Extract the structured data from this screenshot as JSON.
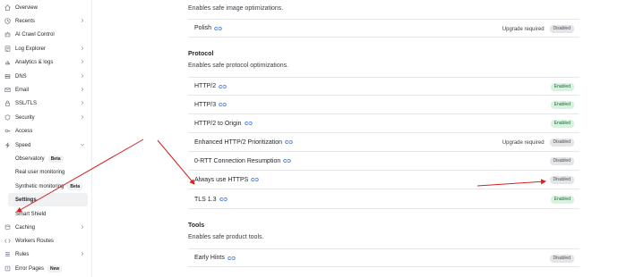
{
  "sidebar": {
    "items": [
      {
        "label": "Overview",
        "icon": "home-icon",
        "chevron": false
      },
      {
        "label": "Recents",
        "icon": "clock-icon",
        "chevron": true
      },
      {
        "label": "AI Crawl Control",
        "icon": "robot-icon",
        "chevron": false
      },
      {
        "label": "Log Explorer",
        "icon": "log-icon",
        "chevron": true
      },
      {
        "label": "Analytics & logs",
        "icon": "chart-icon",
        "chevron": true
      },
      {
        "label": "DNS",
        "icon": "dns-icon",
        "chevron": true
      },
      {
        "label": "Email",
        "icon": "email-icon",
        "chevron": true
      },
      {
        "label": "SSL/TLS",
        "icon": "lock-icon",
        "chevron": true
      },
      {
        "label": "Security",
        "icon": "shield-icon",
        "chevron": true
      },
      {
        "label": "Access",
        "icon": "access-icon",
        "chevron": false
      },
      {
        "label": "Speed",
        "icon": "lightning-icon",
        "chevron": true
      }
    ],
    "speed_sub": {
      "observatory": "Observatory",
      "observatory_badge": "Beta",
      "rum": "Real user monitoring",
      "synthetic": "Synthetic monitoring",
      "synthetic_badge": "Beta",
      "settings": "Settings",
      "smart_shield": "Smart Shield"
    },
    "items_after": [
      {
        "label": "Caching",
        "icon": "caching-icon",
        "chevron": true
      },
      {
        "label": "Workers Routes",
        "icon": "workers-icon",
        "chevron": false
      },
      {
        "label": "Rules",
        "icon": "rules-icon",
        "chevron": true
      },
      {
        "label": "Error Pages",
        "icon": "error-page-icon",
        "badge": "New"
      }
    ]
  },
  "main": {
    "images_desc": "Enables safe image optimizations.",
    "polish": {
      "name": "Polish",
      "note": "Upgrade required",
      "status": "Disabled"
    },
    "protocol": {
      "title": "Protocol",
      "desc": "Enables safe protocol optimizations.",
      "rows": [
        {
          "name": "HTTP/2",
          "note": "",
          "status": "Enabled"
        },
        {
          "name": "HTTP/3",
          "note": "",
          "status": "Enabled"
        },
        {
          "name": "HTTP/2 to Origin",
          "note": "",
          "status": "Enabled"
        },
        {
          "name": "Enhanced HTTP/2 Prioritization",
          "note": "Upgrade required",
          "status": "Disabled"
        },
        {
          "name": "0-RTT Connection Resumption",
          "note": "",
          "status": "Disabled"
        },
        {
          "name": "Always use HTTPS",
          "note": "",
          "status": "Disabled"
        },
        {
          "name": "TLS 1.3",
          "note": "",
          "status": "Enabled"
        }
      ]
    },
    "tools": {
      "title": "Tools",
      "desc": "Enables safe product tools.",
      "rows": [
        {
          "name": "Early Hints",
          "note": "",
          "status": "Disabled"
        }
      ]
    }
  },
  "colors": {
    "accent_link": "#2f6fdb",
    "enabled_bg": "#d7f2df",
    "disabled_bg": "#e4e5e7",
    "annotation_arrow": "#d32020"
  }
}
